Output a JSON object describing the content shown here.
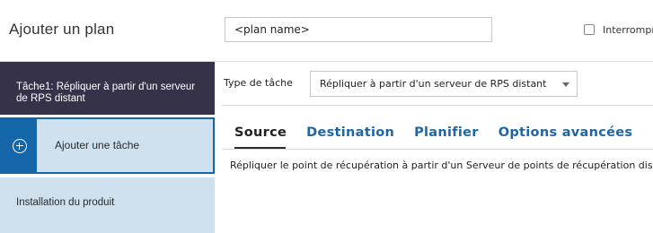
{
  "header": {
    "title": "Ajouter un plan",
    "plan_name_value": "<plan name>",
    "checkbox_label": "Interrompre"
  },
  "sidebar": {
    "task_item": {
      "label": "Tâche1: Répliquer à partir d'un serveur de RPS distant"
    },
    "add_task": {
      "label": "Ajouter une tâche",
      "icon": "plus-circle-icon"
    },
    "install": {
      "label": "Installation du produit"
    }
  },
  "main": {
    "task_type_label": "Type de tâche",
    "task_type_selected": "Répliquer à partir d'un serveur de RPS distant",
    "tabs": [
      {
        "label": "Source",
        "active": true
      },
      {
        "label": "Destination",
        "active": false
      },
      {
        "label": "Planifier",
        "active": false
      },
      {
        "label": "Options avancées",
        "active": false
      }
    ],
    "description": "Répliquer le point de récupération à partir d'un Serveur de points de récupération distant"
  },
  "colors": {
    "sidebar_dark": "#36324a",
    "sidebar_light": "#cfe0ee",
    "accent_blue": "#1565a9",
    "tab_link": "#1d66a8"
  }
}
